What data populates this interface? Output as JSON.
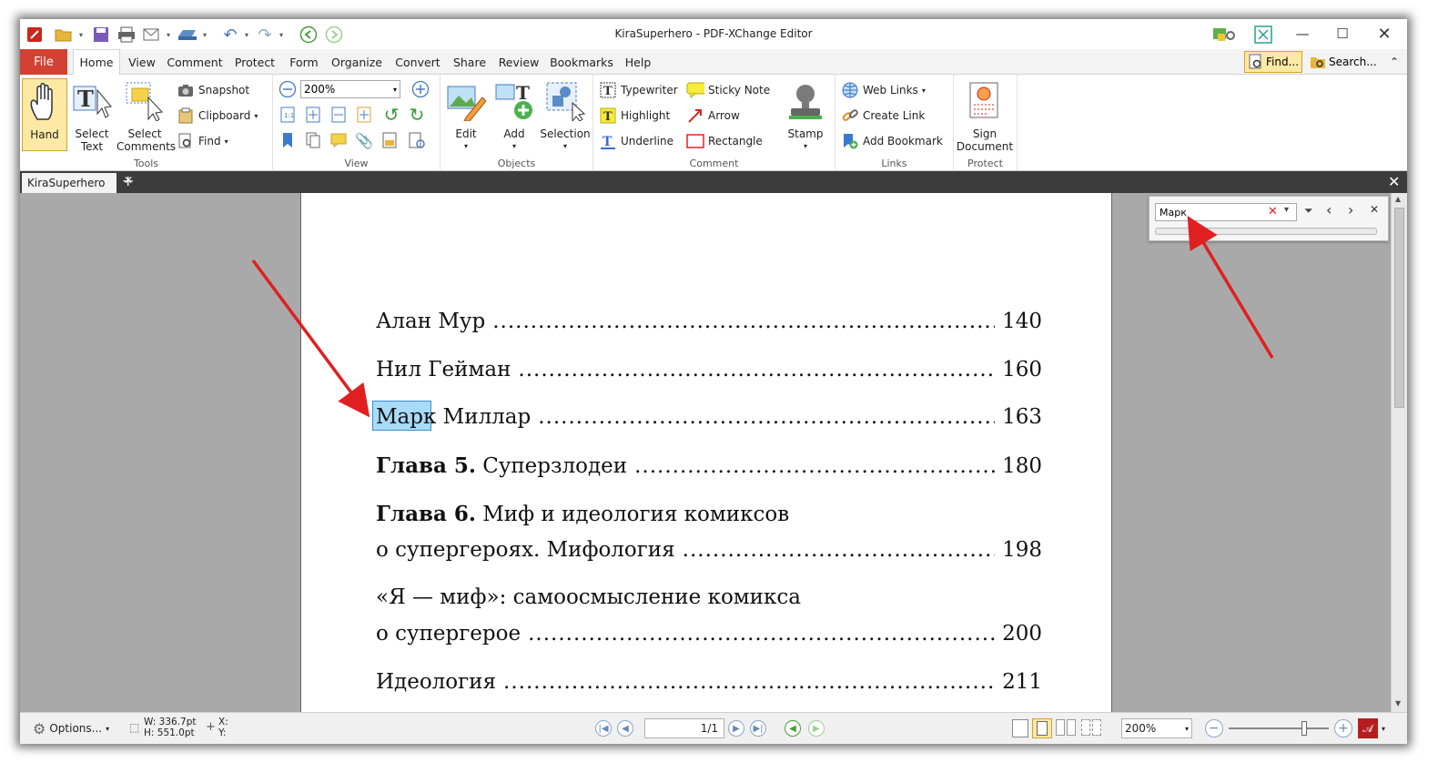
{
  "window": {
    "title": "KiraSuperhero - PDF-XChange Editor"
  },
  "menu": {
    "file": "File",
    "tabs": [
      "Home",
      "View",
      "Comment",
      "Protect",
      "Form",
      "Organize",
      "Convert",
      "Share",
      "Review",
      "Bookmarks",
      "Help"
    ],
    "find": "Find...",
    "search": "Search..."
  },
  "ribbon": {
    "tools": {
      "label": "Tools",
      "hand": "Hand",
      "select_text_1": "Select",
      "select_text_2": "Text",
      "select_comments_1": "Select",
      "select_comments_2": "Comments",
      "snapshot": "Snapshot",
      "clipboard": "Clipboard",
      "find": "Find"
    },
    "view": {
      "label": "View",
      "zoom": "200%"
    },
    "objects": {
      "label": "Objects",
      "edit": "Edit",
      "add": "Add",
      "selection": "Selection"
    },
    "comment": {
      "label": "Comment",
      "typewriter": "Typewriter",
      "highlight": "Highlight",
      "underline": "Underline",
      "sticky_note": "Sticky Note",
      "arrow": "Arrow",
      "rectangle": "Rectangle",
      "stamp": "Stamp"
    },
    "links": {
      "label": "Links",
      "web_links": "Web Links",
      "create_link": "Create Link",
      "add_bookmark": "Add Bookmark"
    },
    "protect": {
      "label": "Protect",
      "sign_1": "Sign",
      "sign_2": "Document"
    }
  },
  "document_tab": {
    "name": "KiraSuperhero"
  },
  "find_panel": {
    "query": "Марк"
  },
  "page": {
    "lines": [
      {
        "text": "Алан Мур",
        "page": "140"
      },
      {
        "text": "Нил Гейман",
        "page": "160"
      },
      {
        "highlight": "Марк",
        "text": " Миллар",
        "page": "163"
      },
      {
        "bold": "Глава 5.",
        "text": " Суперзлодеи",
        "page": "180"
      }
    ],
    "line5a_bold": "Глава 6.",
    "line5a_text": " Миф и идеология комиксов",
    "line5b_text": "о супергероях. Мифология",
    "line5b_page": "198",
    "line6a_text": "«Я — миф»: самоосмысление комикса",
    "line6b_text": "о супергерое",
    "line6b_page": "200",
    "line7_text": "Идеология",
    "line7_page": "211",
    "dots": "................................................................................................................................"
  },
  "status": {
    "options": "Options...",
    "width": "W: 336.7pt",
    "height": "H: 551.0pt",
    "x": "X:",
    "y": "Y:",
    "page_nav": "1/1",
    "zoom": "200%"
  },
  "colors": {
    "file_tab": "#d24132",
    "annotation_arrow": "#e02020",
    "highlight": "#78c8f5",
    "viewer_bg": "#a9a9a9"
  }
}
